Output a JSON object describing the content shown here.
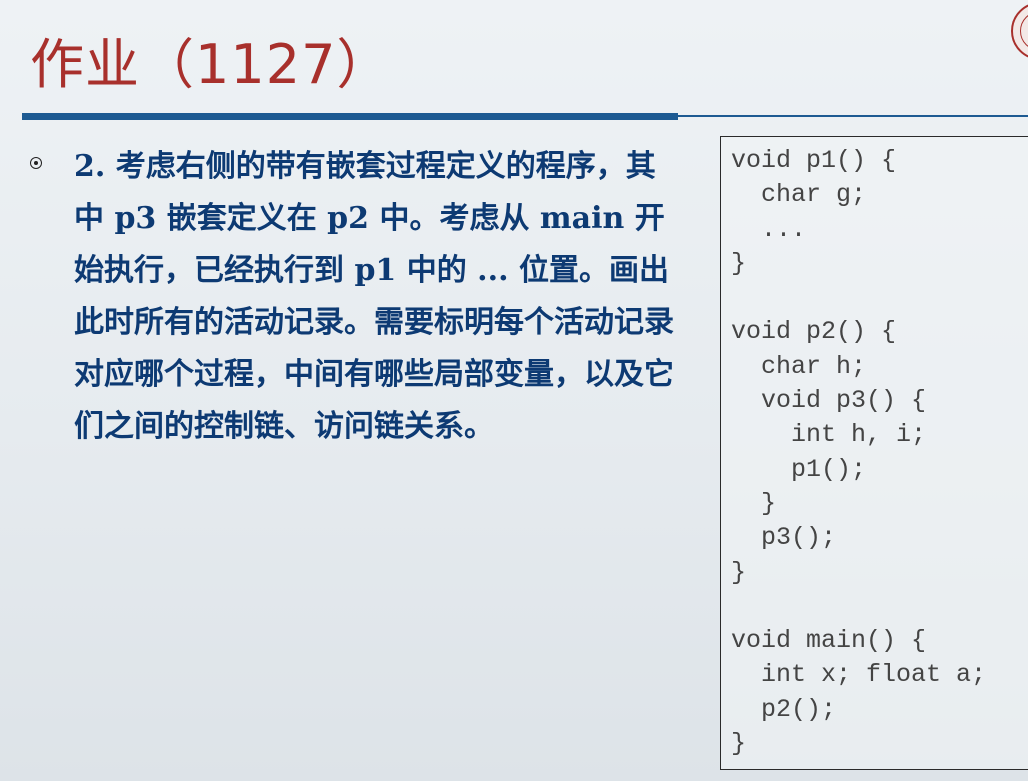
{
  "slide": {
    "title": "作业（1127）"
  },
  "bullet": {
    "text": "2. 考虑右侧的带有嵌套过程定义的程序，其中 p3 嵌套定义在 p2 中。考虑从 main 开始执行，已经执行到 p1 中的 ... 位置。画出此时所有的活动记录。需要标明每个活动记录对应哪个过程，中间有哪些局部变量，以及它们之间的控制链、访问链关系。"
  },
  "code": {
    "text": "void p1() {\n  char g;\n  ...\n}\n\nvoid p2() {\n  char h;\n  void p3() {\n    int h, i;\n    p1();\n  }\n  p3();\n}\n\nvoid main() {\n  int x; float a;\n  p2();\n}"
  },
  "colors": {
    "title": "#a8302c",
    "rule": "#1d5a92",
    "bullet_text": "#0d3a73",
    "code_text": "#444444"
  }
}
